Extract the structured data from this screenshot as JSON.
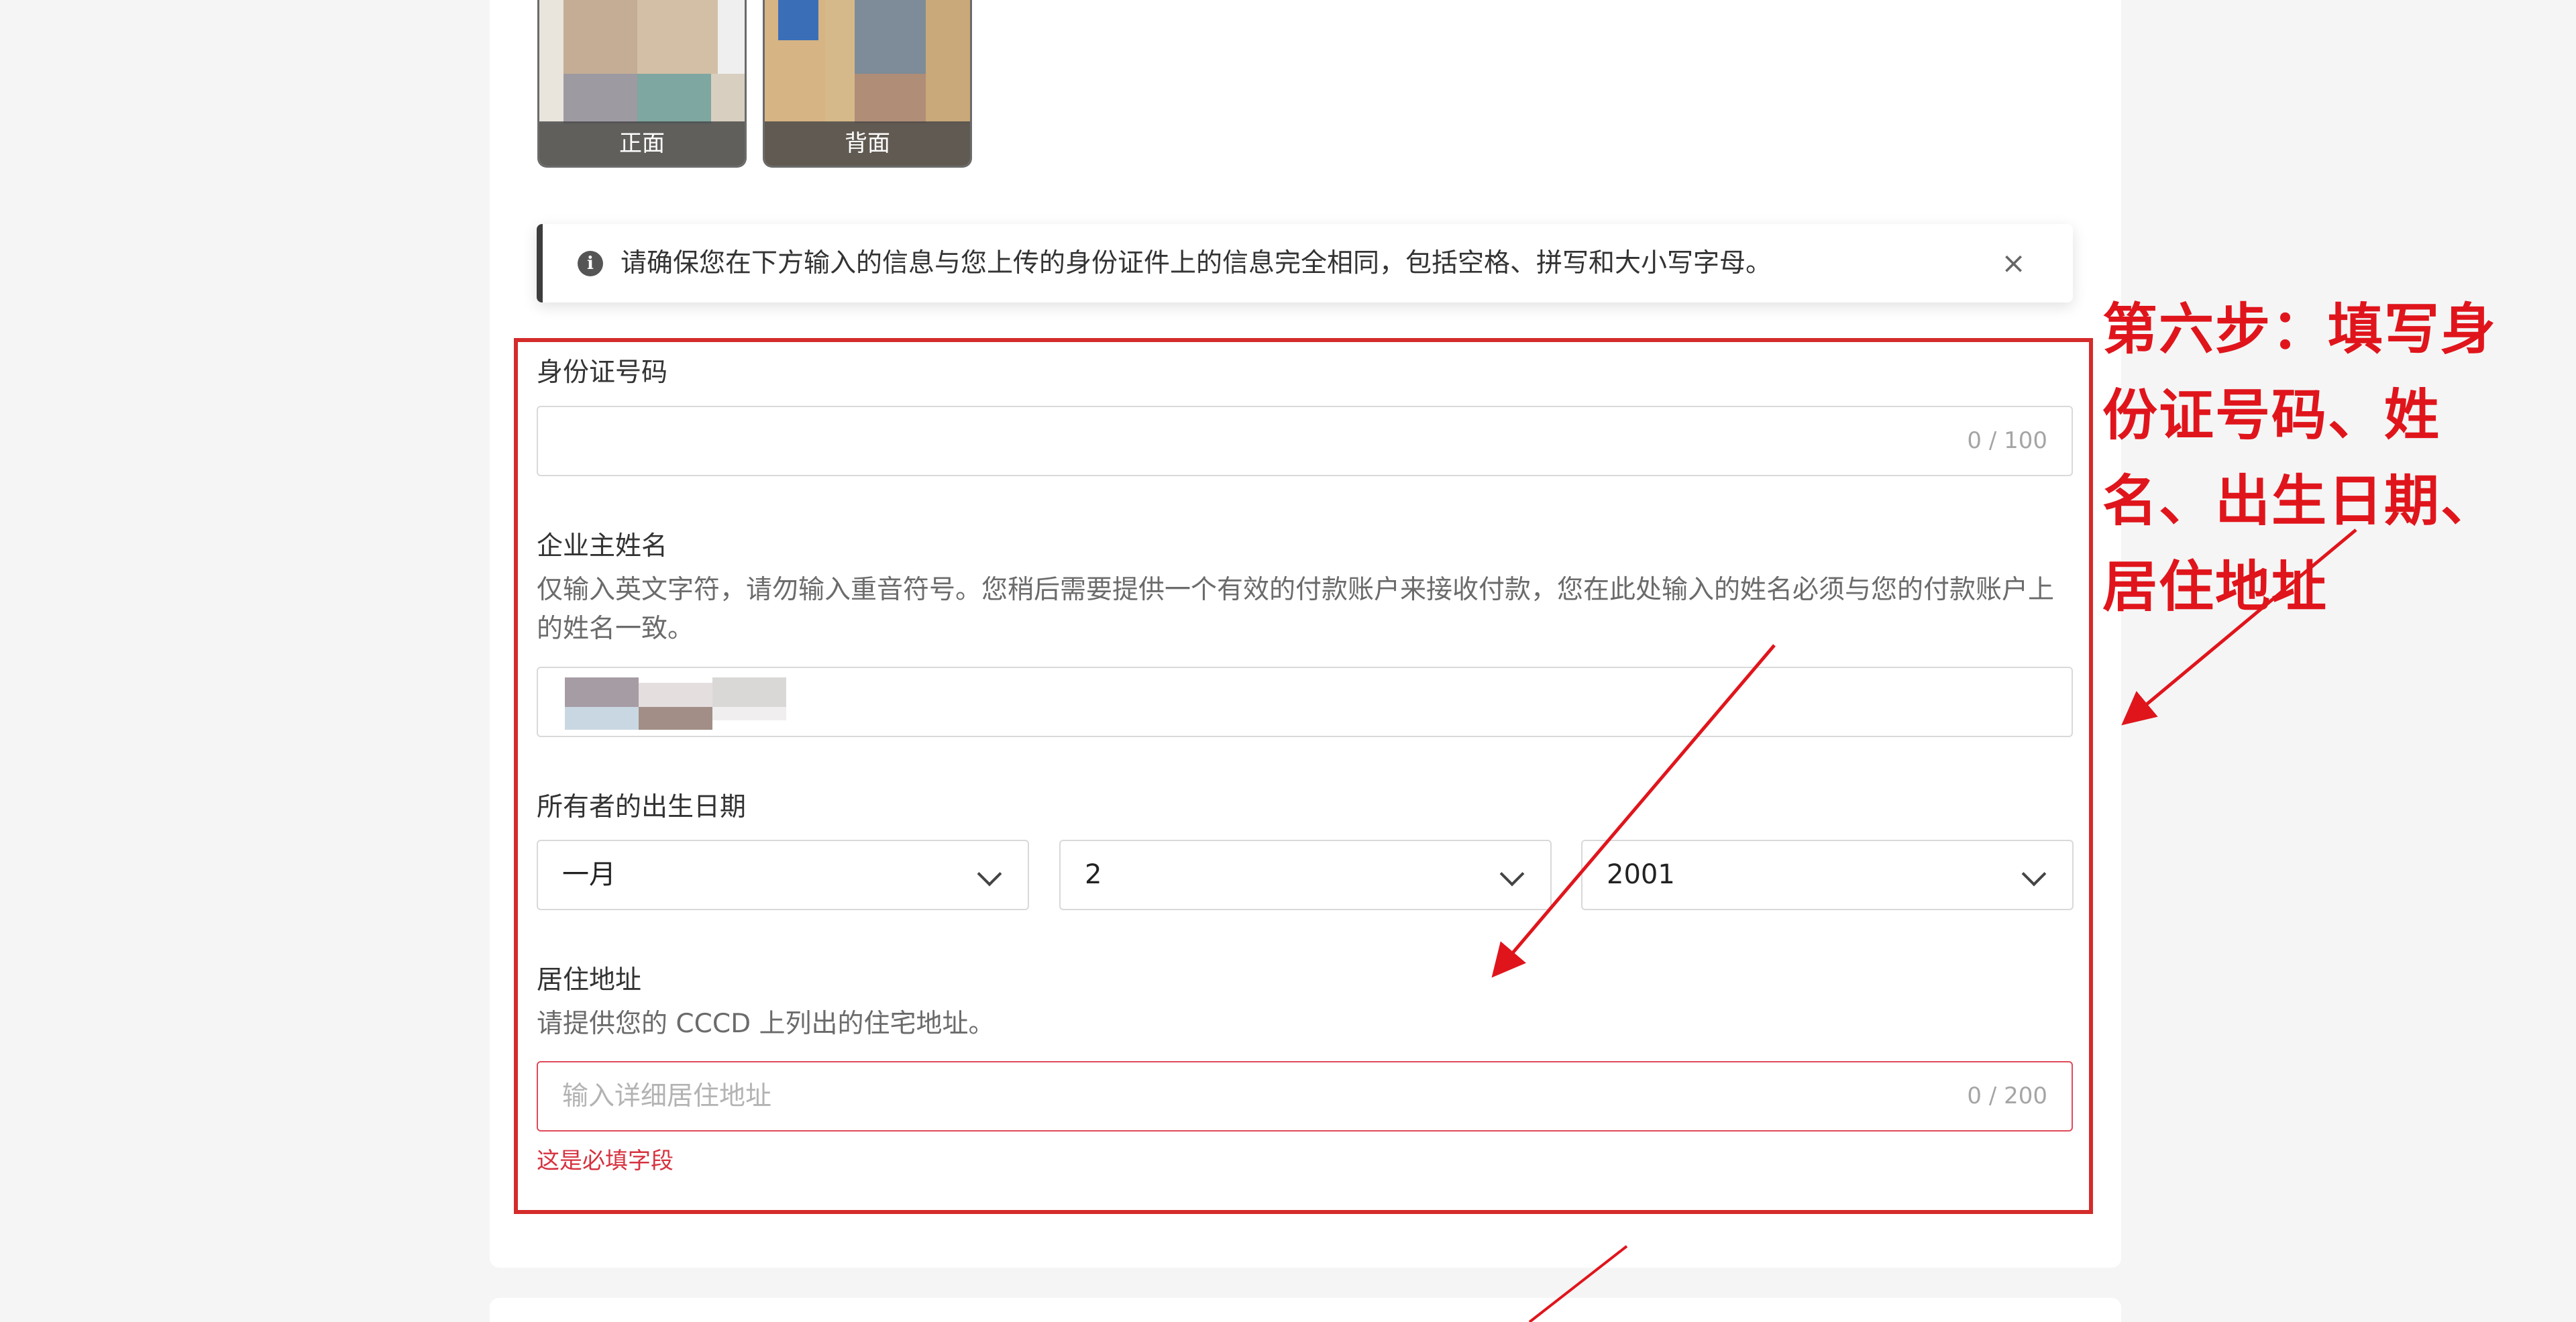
{
  "thumbnails": {
    "front_label": "正面",
    "back_label": "背面"
  },
  "notice": {
    "icon": "info-icon",
    "text": "请确保您在下方输入的信息与您上传的身份证件上的信息完全相同，包括空格、拼写和大小写字母。",
    "close_glyph": "×"
  },
  "id_number": {
    "label": "身份证号码",
    "value": "",
    "counter": "0 / 100"
  },
  "owner_name": {
    "label": "企业主姓名",
    "description": "仅输入英文字符，请勿输入重音符号。您稍后需要提供一个有效的付款账户来接收付款，您在此处输入的姓名必须与您的付款账户上的姓名一致。"
  },
  "birth_date": {
    "label": "所有者的出生日期",
    "month": "一月",
    "day": "2",
    "year": "2001"
  },
  "address": {
    "label": "居住地址",
    "description": "请提供您的 CCCD 上列出的住宅地址。",
    "placeholder": "输入详细居住地址",
    "counter": "0 / 200",
    "error": "这是必填字段"
  },
  "annotation": {
    "text": "第六步：填写身份证号码、姓名、出生日期、居住地址"
  },
  "colors": {
    "highlight_red": "#d42b2b",
    "annotation_red": "#e0151c",
    "error_red": "#d6323f"
  }
}
